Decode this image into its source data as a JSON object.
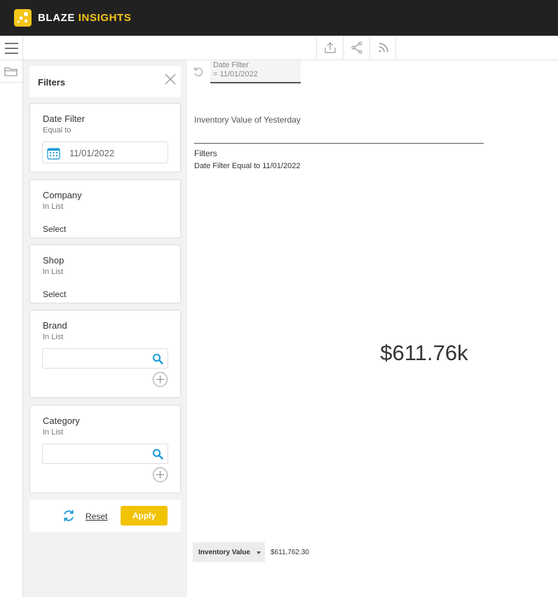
{
  "app": {
    "brand_part1": "BLAZE",
    "brand_part2": "INSIGHTS",
    "accent": "#f5c518"
  },
  "toolbar": {
    "icons": [
      "export-icon",
      "share-icon",
      "rss-icon"
    ]
  },
  "filters_panel": {
    "title": "Filters",
    "date_filter": {
      "title": "Date Filter",
      "operator": "Equal to",
      "value": "11/01/2022"
    },
    "company": {
      "title": "Company",
      "operator": "In List",
      "value": "Select"
    },
    "shop": {
      "title": "Shop",
      "operator": "In List",
      "value": "Select"
    },
    "brand": {
      "title": "Brand",
      "operator": "In List",
      "search_value": ""
    },
    "category": {
      "title": "Category",
      "operator": "In List",
      "search_value": ""
    },
    "reset_label": "Reset",
    "apply_label": "Apply"
  },
  "active_filter_chip": {
    "line1": "Date Filter",
    "line2": "= 11/01/2022"
  },
  "report": {
    "title": "Inventory Value of Yesterday",
    "filters_heading": "Filters",
    "filters_description": "Date Filter Equal to 11/01/2022",
    "kpi_value": "$611.76k",
    "legend_label": "Inventory Value",
    "legend_value": "$611,762.30"
  }
}
